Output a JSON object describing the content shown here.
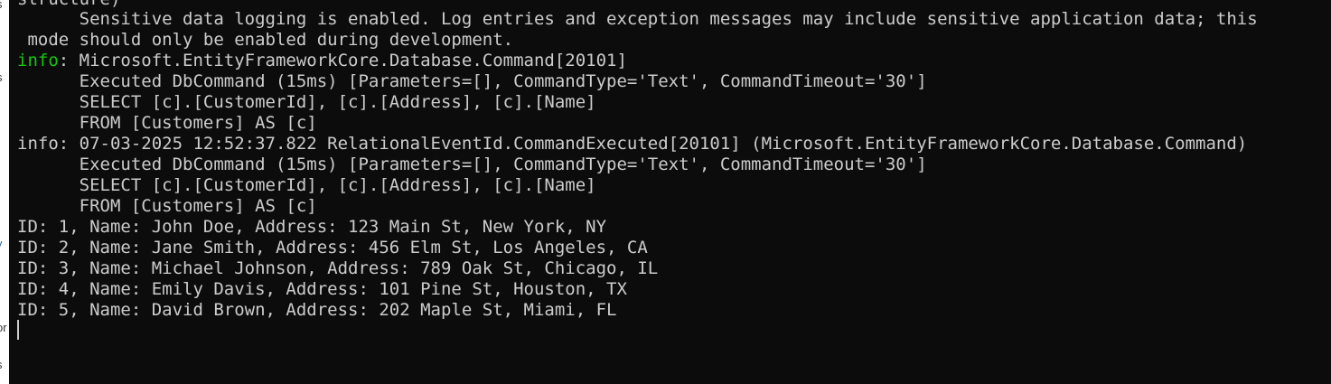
{
  "background_window": {
    "fragments": [
      "s",
      "s",
      "y",
      "or",
      "s"
    ]
  },
  "terminal": {
    "lines": [
      {
        "text": "structure)"
      },
      {
        "text": "      Sensitive data logging is enabled. Log entries and exception messages may include sensitive application data; this"
      },
      {
        "text": " mode should only be enabled during development."
      },
      {
        "prefix": "info",
        "text": ": Microsoft.EntityFrameworkCore.Database.Command[20101]"
      },
      {
        "text": "      Executed DbCommand (15ms) [Parameters=[], CommandType='Text', CommandTimeout='30']"
      },
      {
        "text": "      SELECT [c].[CustomerId], [c].[Address], [c].[Name]"
      },
      {
        "text": "      FROM [Customers] AS [c]"
      },
      {
        "text": "info: 07-03-2025 12:52:37.822 RelationalEventId.CommandExecuted[20101] (Microsoft.EntityFrameworkCore.Database.Command)"
      },
      {
        "text": "      Executed DbCommand (15ms) [Parameters=[], CommandType='Text', CommandTimeout='30']"
      },
      {
        "text": "      SELECT [c].[CustomerId], [c].[Address], [c].[Name]"
      },
      {
        "text": "      FROM [Customers] AS [c]"
      },
      {
        "text": "ID: 1, Name: John Doe, Address: 123 Main St, New York, NY"
      },
      {
        "text": "ID: 2, Name: Jane Smith, Address: 456 Elm St, Los Angeles, CA"
      },
      {
        "text": "ID: 3, Name: Michael Johnson, Address: 789 Oak St, Chicago, IL"
      },
      {
        "text": "ID: 4, Name: Emily Davis, Address: 101 Pine St, Houston, TX"
      },
      {
        "text": "ID: 5, Name: David Brown, Address: 202 Maple St, Miami, FL"
      }
    ],
    "colors": {
      "background": "#0c0c0c",
      "foreground": "#cccccc",
      "info_prefix": "#16c60c"
    }
  }
}
